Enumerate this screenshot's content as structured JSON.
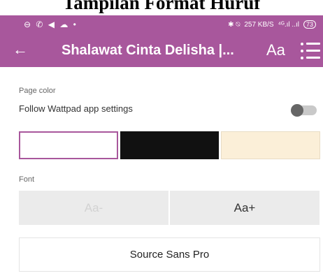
{
  "document": {
    "title": "Tampilan Format Huruf"
  },
  "status_bar": {
    "left_icons": [
      "notification-icon",
      "whatsapp-icon",
      "telegram-icon",
      "gallery-icon",
      "dot-icon"
    ],
    "left_text": "⊖ ✆ ◀ ☁ •",
    "right": {
      "icons_text": "✱ ⍉",
      "speed": "257 KB/S",
      "network": "⁴ᴳ.ıl ..ıl",
      "battery": "73"
    }
  },
  "app_bar": {
    "back_glyph": "←",
    "title": "Shalawat Cinta Delisha |...",
    "font_button": "Aa"
  },
  "page_color": {
    "section_label": "Page color",
    "follow_label": "Follow Wattpad app settings",
    "follow_enabled": false,
    "swatches": [
      "#ffffff",
      "#111111",
      "#fbefd8"
    ],
    "selected": "#ffffff"
  },
  "font": {
    "section_label": "Font",
    "decrease_label": "Aa-",
    "increase_label": "Aa+",
    "family_label": "Source Sans Pro"
  },
  "colors": {
    "accent": "#a8579c"
  }
}
